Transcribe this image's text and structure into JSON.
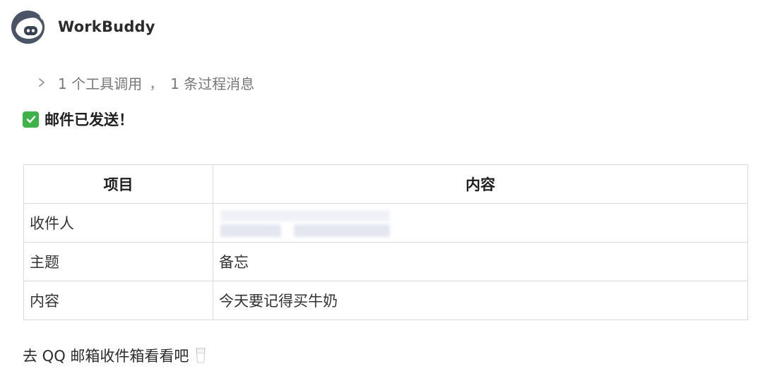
{
  "header": {
    "app_name": "WorkBuddy",
    "avatar_icon": "robot-icon"
  },
  "tool_summary": {
    "icon": "chevron-right-icon",
    "tool_calls": "1 个工具调用",
    "separator": "，",
    "process_messages": "1 条过程消息"
  },
  "status": {
    "icon": "check-mark-button-icon",
    "text": "邮件已发送！"
  },
  "table": {
    "headers": [
      "项目",
      "内容"
    ],
    "rows": [
      {
        "item": "收件人",
        "content": ""
      },
      {
        "item": "主题",
        "content": "备忘"
      },
      {
        "item": "内容",
        "content": "今天要记得买牛奶"
      }
    ]
  },
  "footer": {
    "text": "去 QQ 邮箱收件箱看看吧",
    "icon": "milk-glass-icon"
  },
  "colors": {
    "check_green": "#3fb24a",
    "table_border": "#d6dae2",
    "muted_text": "#777777"
  }
}
